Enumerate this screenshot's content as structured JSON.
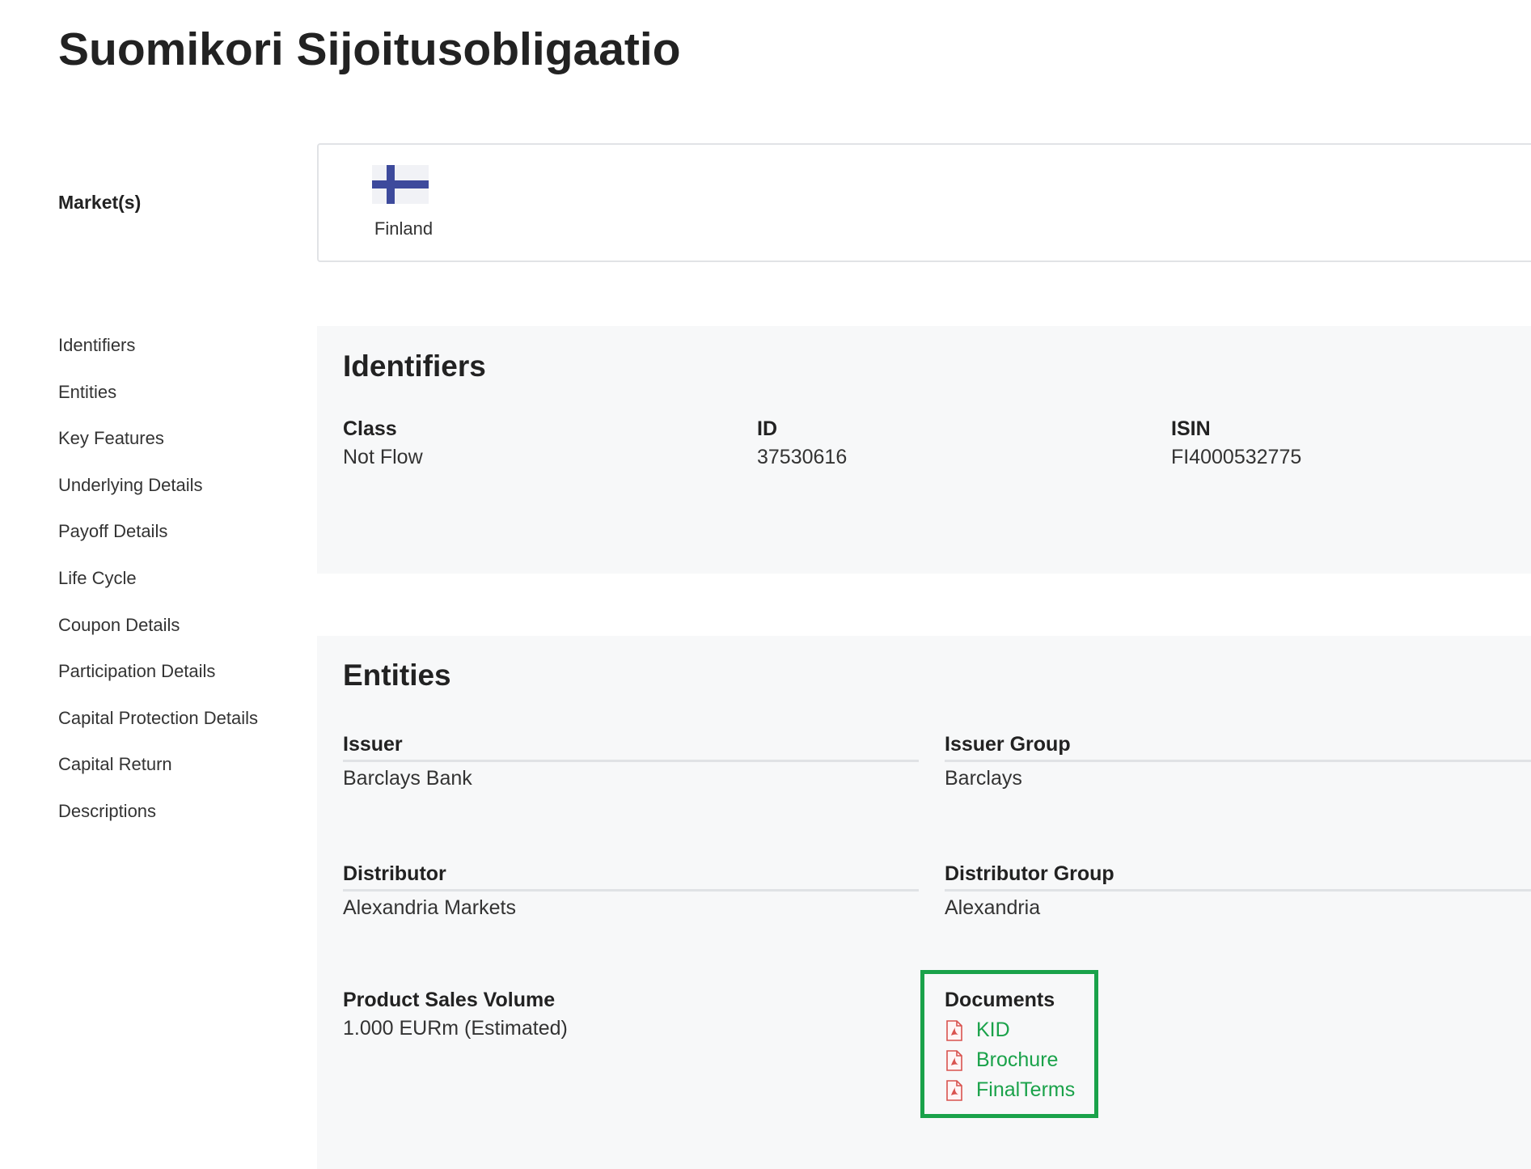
{
  "page": {
    "title": "Suomikori Sijoitusobligaatio"
  },
  "markets": {
    "label": "Market(s)",
    "items": [
      {
        "name": "Finland",
        "icon": "finland-flag-icon"
      }
    ]
  },
  "sidebar": {
    "items": [
      {
        "label": "Identifiers"
      },
      {
        "label": "Entities"
      },
      {
        "label": "Key Features"
      },
      {
        "label": "Underlying Details"
      },
      {
        "label": "Payoff Details"
      },
      {
        "label": "Life Cycle"
      },
      {
        "label": "Coupon Details"
      },
      {
        "label": "Participation Details"
      },
      {
        "label": "Capital Protection Details"
      },
      {
        "label": "Capital Return"
      },
      {
        "label": "Descriptions"
      }
    ]
  },
  "identifiers": {
    "title": "Identifiers",
    "class": {
      "label": "Class",
      "value": "Not Flow"
    },
    "id": {
      "label": "ID",
      "value": "37530616"
    },
    "isin": {
      "label": "ISIN",
      "value": "FI4000532775"
    }
  },
  "entities": {
    "title": "Entities",
    "issuer": {
      "label": "Issuer",
      "value": "Barclays Bank"
    },
    "issuer_group": {
      "label": "Issuer Group",
      "value": "Barclays"
    },
    "distributor": {
      "label": "Distributor",
      "value": "Alexandria Markets"
    },
    "distributor_group": {
      "label": "Distributor Group",
      "value": "Alexandria"
    },
    "sales_volume": {
      "label": "Product Sales Volume",
      "value": "1.000 EURm (Estimated)"
    },
    "documents": {
      "label": "Documents",
      "items": [
        {
          "label": "KID",
          "icon": "pdf-icon"
        },
        {
          "label": "Brochure",
          "icon": "pdf-icon"
        },
        {
          "label": "FinalTerms",
          "icon": "pdf-icon"
        }
      ]
    }
  },
  "colors": {
    "link": "#1aa24a",
    "highlight_border": "#1aa24a",
    "panel_bg": "#f7f8f9",
    "flag_blue": "#3d4a9c",
    "pdf_red": "#d9534f"
  }
}
